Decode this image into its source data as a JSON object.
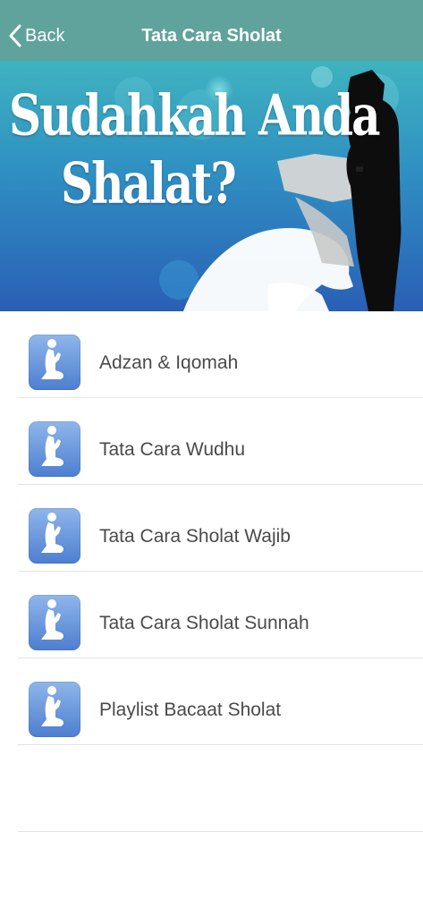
{
  "navbar": {
    "back_label": "Back",
    "title": "Tata Cara Sholat",
    "background": "#5fa39c"
  },
  "banner": {
    "line1": "Sudahkah Anda",
    "line2": "Shalat?"
  },
  "menu": {
    "items": [
      {
        "label": "Adzan & Iqomah",
        "icon": "praying-person-icon"
      },
      {
        "label": "Tata Cara Wudhu",
        "icon": "praying-person-icon"
      },
      {
        "label": "Tata Cara Sholat Wajib",
        "icon": "praying-person-icon"
      },
      {
        "label": "Tata Cara Sholat Sunnah",
        "icon": "praying-person-icon"
      },
      {
        "label": "Playlist Bacaat Sholat",
        "icon": "praying-person-icon"
      }
    ]
  }
}
